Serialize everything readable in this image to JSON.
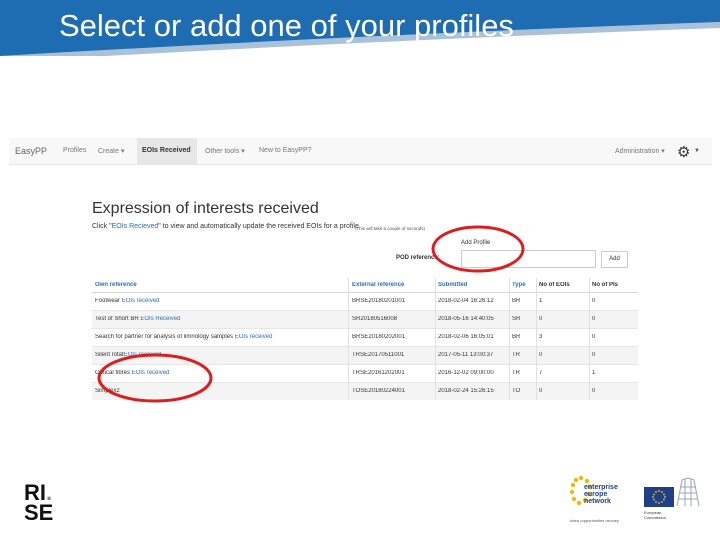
{
  "slide": {
    "title": "Select or add one of your profiles",
    "banner_color": "#1e6db2"
  },
  "app": {
    "brand": "EasyPP",
    "nav": [
      {
        "label": "Profiles"
      },
      {
        "label": "Create ▾"
      },
      {
        "label": "EOIs Received",
        "active": true
      },
      {
        "label": "Other tools ▾"
      },
      {
        "label": "New to EasyPP?"
      }
    ],
    "admin_label": "Administration ▾",
    "gear_icon": "gear-icon",
    "heading": "Expression of interests received",
    "subtitle_prefix": "Click \"",
    "subtitle_link": "EOIs Recieved",
    "subtitle_suffix": "\" to view and automatically update the received EOIs for a profile.",
    "subtitle_note": "(This will take a couple of seconds)",
    "add_profile_label": "Add Profile",
    "pcd_label": "POD reference:",
    "pcd_value": "",
    "add_button": "Add",
    "accent_color": "#2a6ebb",
    "table": {
      "headers": [
        "Own reference",
        "External reference",
        "Submitted",
        "Type",
        "No of EOIs",
        "No of PIs"
      ],
      "rows": [
        {
          "own": "Footwear ",
          "link": "EOIs received",
          "ext": "BRSE20180201001",
          "submitted": "2018-02-04 16:26:12",
          "type": "BR",
          "eois": "1",
          "pis": "0",
          "alt": false
        },
        {
          "own": "Test of Short BR ",
          "link": "EOIs Received",
          "ext": "SR20180516008",
          "submitted": "2018-05-16 14:40:05",
          "type": "SR",
          "eois": "0",
          "pis": "0",
          "alt": true
        },
        {
          "own": "Search for partner for analysis of limnology samples   ",
          "link": "EOIs received",
          "ext": "BRSE20180202001",
          "submitted": "2018-02-06 16:05:01",
          "type": "BR",
          "eois": "3",
          "pis": "0",
          "alt": false
        },
        {
          "own": "Silent rotat",
          "link": "EOIs received",
          "ext": "TRSE20170511001",
          "submitted": "2017-05-11 13:00:37",
          "type": "TR",
          "eois": "0",
          "pis": "0",
          "alt": true
        },
        {
          "own": "Optical fibres ",
          "link": "EOIs received",
          "ext": "TRSE20161202001",
          "submitted": "2016-12-02 09:00:00",
          "type": "TR",
          "eois": "7",
          "pis": "1",
          "alt": false
        },
        {
          "own": "Simplex2 ",
          "link": "",
          "ext": "TOSE20180224001",
          "submitted": "2018-02-24 15:26:15",
          "type": "TO",
          "eois": "0",
          "pis": "0",
          "alt": true
        }
      ]
    }
  },
  "logos": {
    "rise": "RI.\nSE",
    "een_name": "enterprise\neurope\nnetwork",
    "een_tagline": "•idea •opportunities •money",
    "eu_text": "European\nCommission"
  },
  "annotation_color": "#e01b1b"
}
